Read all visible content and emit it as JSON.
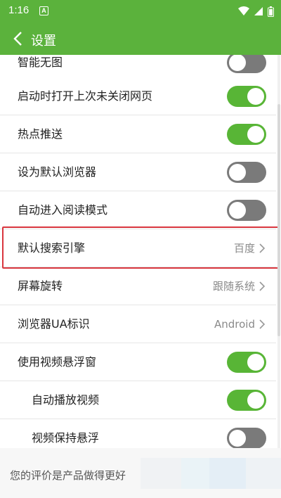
{
  "status": {
    "time": "1:16",
    "notification": "A"
  },
  "header": {
    "title": "设置"
  },
  "settings": [
    {
      "label": "智能无图",
      "type": "toggle",
      "on": false
    },
    {
      "label": "启动时打开上次未关闭网页",
      "type": "toggle",
      "on": true
    },
    {
      "label": "热点推送",
      "type": "toggle",
      "on": true
    },
    {
      "label": "设为默认浏览器",
      "type": "toggle",
      "on": false
    },
    {
      "label": "自动进入阅读模式",
      "type": "toggle",
      "on": false
    },
    {
      "label": "默认搜索引擎",
      "type": "select",
      "value": "百度"
    },
    {
      "label": "屏幕旋转",
      "type": "select",
      "value": "跟随系统"
    },
    {
      "label": "浏览器UA标识",
      "type": "select",
      "value": "Android"
    },
    {
      "label": "使用视频悬浮窗",
      "type": "toggle",
      "on": true
    },
    {
      "label": "自动播放视频",
      "type": "toggle",
      "on": true
    },
    {
      "label": "视频保持悬浮",
      "type": "toggle",
      "on": false
    }
  ],
  "footer": {
    "feedback_text": "您的评价是产品做得更好"
  },
  "colors": {
    "accent": "#5bb23c",
    "toggle_on": "#58b536",
    "toggle_off": "#7a7a7a",
    "highlight": "#d9363e"
  }
}
